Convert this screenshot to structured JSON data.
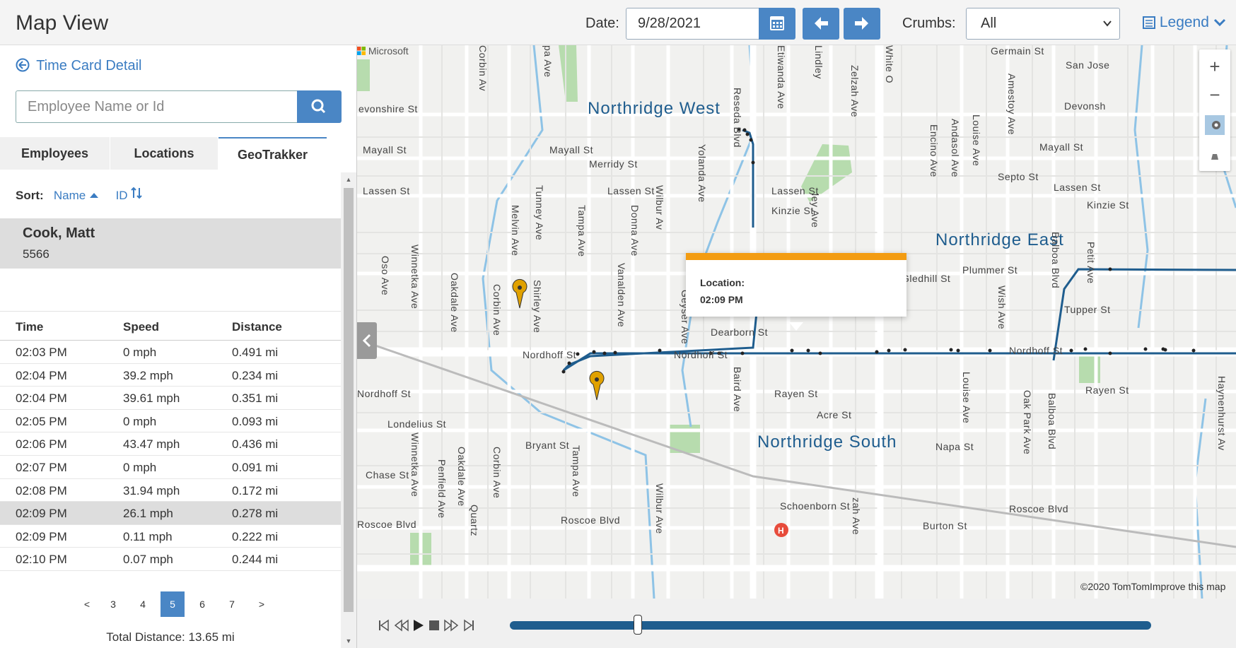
{
  "header": {
    "title": "Map View",
    "date_label": "Date:",
    "date_value": "9/28/2021",
    "crumbs_label": "Crumbs:",
    "crumbs_selected": "All",
    "legend_label": "Legend"
  },
  "left": {
    "back_link": "Time Card Detail",
    "search_placeholder": "Employee Name or Id",
    "tabs": [
      "Employees",
      "Locations",
      "GeoTrakker"
    ],
    "active_tab": "GeoTrakker",
    "sort_label": "Sort:",
    "sort_name": "Name",
    "sort_id": "ID",
    "employee": {
      "name": "Cook, Matt",
      "id": "5566"
    },
    "table": {
      "headers": [
        "Time",
        "Speed",
        "Distance"
      ],
      "rows": [
        [
          "02:03 PM",
          "0 mph",
          "0.491 mi"
        ],
        [
          "02:04 PM",
          "39.2 mph",
          "0.234 mi"
        ],
        [
          "02:04 PM",
          "39.61 mph",
          "0.351 mi"
        ],
        [
          "02:05 PM",
          "0 mph",
          "0.093 mi"
        ],
        [
          "02:06 PM",
          "43.47 mph",
          "0.436 mi"
        ],
        [
          "02:07 PM",
          "0 mph",
          "0.091 mi"
        ],
        [
          "02:08 PM",
          "31.94 mph",
          "0.172 mi"
        ],
        [
          "02:09 PM",
          "26.1 mph",
          "0.278 mi"
        ],
        [
          "02:09 PM",
          "0.11 mph",
          "0.222 mi"
        ],
        [
          "02:10 PM",
          "0.07 mph",
          "0.244 mi"
        ]
      ],
      "selected_row": 7
    },
    "pager": {
      "prev": "<",
      "pages": [
        "3",
        "4",
        "5",
        "6",
        "7"
      ],
      "active": "5",
      "next": ">"
    },
    "total_distance": "Total Distance: 13.65 mi"
  },
  "map": {
    "attribution": "Microsoft",
    "copyright": "©2020 TomTomImprove this map",
    "zoom_in": "+",
    "zoom_out": "−",
    "areas": [
      "Northridge West",
      "Northridge East",
      "Northridge South"
    ],
    "streets": {
      "horizontal": [
        "evonshire St",
        "Mayall St",
        "Mayall St",
        "Merridy St",
        "Lassen St",
        "Lassen St",
        "Lassen St",
        "Kinzie St",
        "Nordhoff St",
        "Nordhoff St",
        "Nordhoff St",
        "Nordhoff St",
        "Dearborn St",
        "Rayen St",
        "Acre St",
        "Londelius St",
        "Bryant St",
        "Chase St",
        "Roscoe Blvd",
        "Roscoe Blvd",
        "Roscoe Blvd",
        "Schoenborn St",
        "Burton St",
        "Germain St",
        "San Jose",
        "Devonsh",
        "Mayall St",
        "Septo St",
        "Lassen St",
        "Kinzie St",
        "Plummer St",
        "Gledhill St",
        "Tupper St",
        "Rayen St",
        "Napa St"
      ],
      "vertical": [
        "Corbin Av",
        "pa Ave",
        "Reseda Blvd",
        "Etiwanda Ave",
        "Lindley",
        "Zelzah Ave",
        "White O",
        "Yolanda Ave",
        "Wilbur Av",
        "Donna Ave",
        "Tampa Ave",
        "Tunney Ave",
        "Melvin Ave",
        "Oso Ave",
        "Winnetka Ave",
        "Oakdale Ave",
        "Corbin Ave",
        "Shirley Ave",
        "Vanalden Ave",
        "Geyser Ave",
        "Baird Ave",
        "Zelzah Ave",
        "Encino Ave",
        "Andasol Ave",
        "Louise Ave",
        "Amestoy Ave",
        "Balboa Blvd",
        "Petit Ave",
        "Wish Ave",
        "Louise Ave",
        "Oak Park Ave",
        "Balboa Blvd",
        "Winnetka Ave",
        "Penfield Ave",
        "Oakdale Ave",
        "Corbin Ave",
        "Tampa Ave",
        "Wilbur Ave",
        "Quartz",
        "zah Ave",
        "Haynenhurst Av",
        "ley Ave"
      ]
    },
    "popup": {
      "label": "Location:",
      "time": "02:09 PM"
    },
    "colors": {
      "route": "#1f5d8e",
      "popup_accent": "#f39c12",
      "pin": "#e0a100",
      "water": "#8ec3e6",
      "park": "#b7dcae"
    }
  },
  "player": {
    "icons": [
      "skip-start-icon",
      "rewind-icon",
      "play-icon",
      "stop-icon",
      "fast-forward-icon",
      "skip-end-icon"
    ],
    "progress": 0.2
  }
}
